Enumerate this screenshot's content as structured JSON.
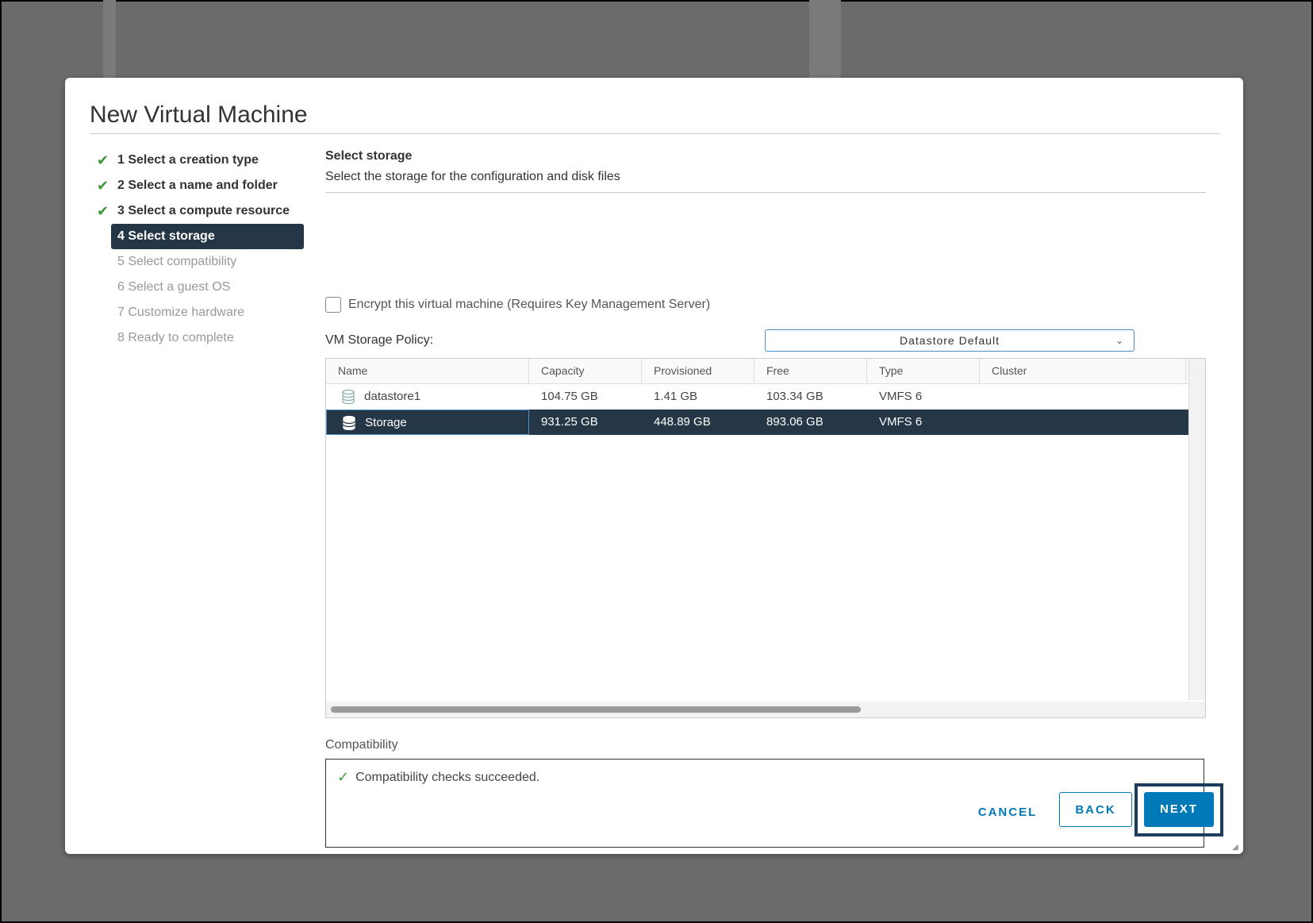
{
  "dialog": {
    "title": "New Virtual Machine",
    "steps": [
      {
        "label": "1 Select a creation type",
        "state": "done"
      },
      {
        "label": "2 Select a name and folder",
        "state": "done"
      },
      {
        "label": "3 Select a compute resource",
        "state": "done"
      },
      {
        "label": "4 Select storage",
        "state": "active"
      },
      {
        "label": "5 Select compatibility",
        "state": "todo"
      },
      {
        "label": "6 Select a guest OS",
        "state": "todo"
      },
      {
        "label": "7 Customize hardware",
        "state": "todo"
      },
      {
        "label": "8 Ready to complete",
        "state": "todo"
      }
    ]
  },
  "section": {
    "title": "Select storage",
    "description": "Select the storage for the configuration and disk files"
  },
  "encrypt": {
    "label": "Encrypt this virtual machine (Requires Key Management Server)",
    "checked": false
  },
  "policy": {
    "label": "VM Storage Policy:",
    "value": "Datastore Default"
  },
  "grid": {
    "columns": [
      "Name",
      "Capacity",
      "Provisioned",
      "Free",
      "Type",
      "Cluster"
    ],
    "rows": [
      {
        "name": "datastore1",
        "capacity": "104.75 GB",
        "provisioned": "1.41 GB",
        "free": "103.34 GB",
        "type": "VMFS 6",
        "cluster": "",
        "selected": false
      },
      {
        "name": "Storage",
        "capacity": "931.25 GB",
        "provisioned": "448.89 GB",
        "free": "893.06 GB",
        "type": "VMFS 6",
        "cluster": "",
        "selected": true
      }
    ]
  },
  "compatibility": {
    "label": "Compatibility",
    "message": "Compatibility checks succeeded."
  },
  "buttons": {
    "cancel": "CANCEL",
    "back": "BACK",
    "next": "NEXT"
  },
  "colors": {
    "accent": "#0079b8",
    "selected_bg": "#253746",
    "check_green": "#3a9a3a"
  }
}
